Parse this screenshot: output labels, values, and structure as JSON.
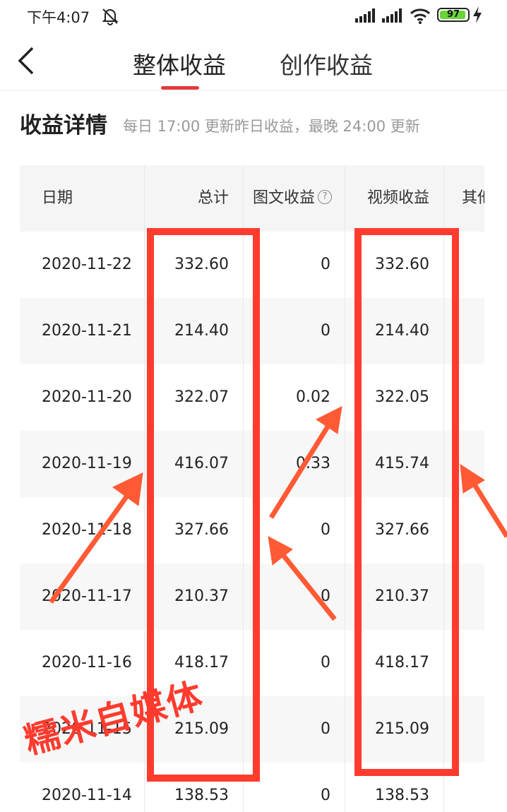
{
  "status": {
    "time": "下午4:07",
    "battery": "97"
  },
  "nav": {
    "tabs": [
      "整体收益",
      "创作收益"
    ]
  },
  "section": {
    "title": "收益详情",
    "note": "每日 17:00 更新昨日收益，最晚 24:00 更新"
  },
  "table": {
    "headers": {
      "date": "日期",
      "total": "总计",
      "text": "图文收益",
      "help": "?",
      "video": "视频收益",
      "other": "其他"
    },
    "rows": [
      {
        "date": "2020-11-22",
        "total": "332.60",
        "text": "0",
        "video": "332.60"
      },
      {
        "date": "2020-11-21",
        "total": "214.40",
        "text": "0",
        "video": "214.40"
      },
      {
        "date": "2020-11-20",
        "total": "322.07",
        "text": "0.02",
        "video": "322.05"
      },
      {
        "date": "2020-11-19",
        "total": "416.07",
        "text": "0.33",
        "video": "415.74"
      },
      {
        "date": "2020-11-18",
        "total": "327.66",
        "text": "0",
        "video": "327.66"
      },
      {
        "date": "2020-11-17",
        "total": "210.37",
        "text": "0",
        "video": "210.37"
      },
      {
        "date": "2020-11-16",
        "total": "418.17",
        "text": "0",
        "video": "418.17"
      },
      {
        "date": "2020-11-15",
        "total": "215.09",
        "text": "0",
        "video": "215.09"
      },
      {
        "date": "2020-11-14",
        "total": "138.53",
        "text": "0",
        "video": "138.53"
      }
    ]
  },
  "watermark": "糯米自媒体",
  "colors": {
    "accent": "#e33a3a",
    "annotation": "#ff3b2e"
  }
}
